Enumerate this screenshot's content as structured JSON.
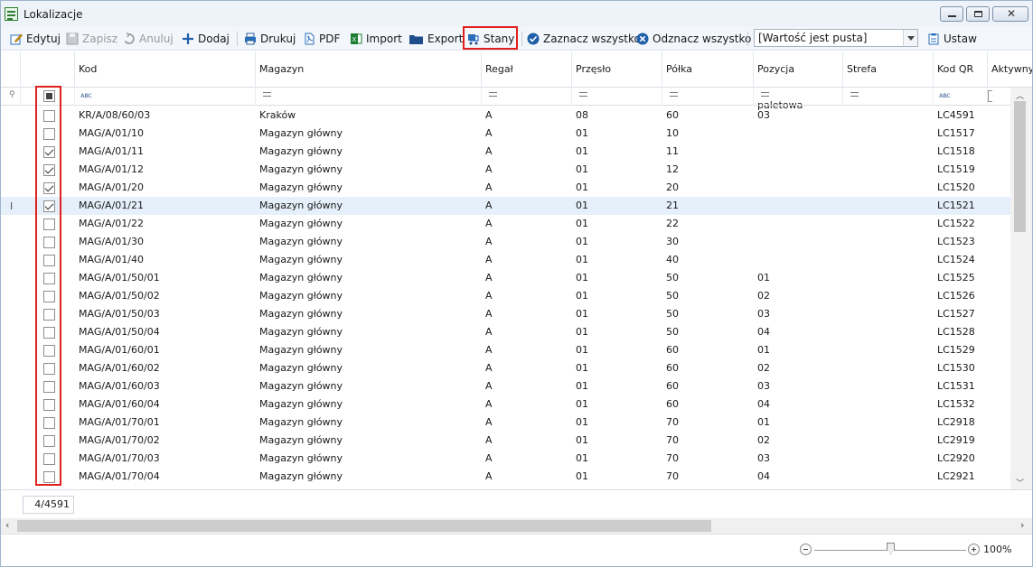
{
  "window": {
    "title": "Lokalizacje"
  },
  "toolbar": {
    "edit": "Edytuj",
    "save": "Zapisz",
    "cancel": "Anuluj",
    "add": "Dodaj",
    "print": "Drukuj",
    "pdf": "PDF",
    "import": "Import",
    "export": "Export",
    "stock": "Stany",
    "select_all": "Zaznacz wszystko",
    "deselect_all": "Odznacz wszystko",
    "filter_value": "[Wartość jest pusta]",
    "set": "Ustaw"
  },
  "columns": [
    "Kod",
    "Magazyn",
    "Regał",
    "Przęsło",
    "Półka",
    "Pozycja paletowa",
    "Strefa",
    "Kod QR",
    "Aktywny"
  ],
  "rows": [
    {
      "checked": false,
      "kod": "KR/A/08/60/03",
      "magazyn": "Kraków",
      "regal": "A",
      "przeslo": "08",
      "polka": "60",
      "pozycja": "03",
      "strefa": "",
      "qr": "LC4591"
    },
    {
      "checked": false,
      "kod": "MAG/A/01/10",
      "magazyn": "Magazyn główny",
      "regal": "A",
      "przeslo": "01",
      "polka": "10",
      "pozycja": "",
      "strefa": "",
      "qr": "LC1517"
    },
    {
      "checked": true,
      "kod": "MAG/A/01/11",
      "magazyn": "Magazyn główny",
      "regal": "A",
      "przeslo": "01",
      "polka": "11",
      "pozycja": "",
      "strefa": "",
      "qr": "LC1518"
    },
    {
      "checked": true,
      "kod": "MAG/A/01/12",
      "magazyn": "Magazyn główny",
      "regal": "A",
      "przeslo": "01",
      "polka": "12",
      "pozycja": "",
      "strefa": "",
      "qr": "LC1519"
    },
    {
      "checked": true,
      "kod": "MAG/A/01/20",
      "magazyn": "Magazyn główny",
      "regal": "A",
      "przeslo": "01",
      "polka": "20",
      "pozycja": "",
      "strefa": "",
      "qr": "LC1520"
    },
    {
      "checked": true,
      "current": true,
      "kod": "MAG/A/01/21",
      "magazyn": "Magazyn główny",
      "regal": "A",
      "przeslo": "01",
      "polka": "21",
      "pozycja": "",
      "strefa": "",
      "qr": "LC1521"
    },
    {
      "checked": false,
      "kod": "MAG/A/01/22",
      "magazyn": "Magazyn główny",
      "regal": "A",
      "przeslo": "01",
      "polka": "22",
      "pozycja": "",
      "strefa": "",
      "qr": "LC1522"
    },
    {
      "checked": false,
      "kod": "MAG/A/01/30",
      "magazyn": "Magazyn główny",
      "regal": "A",
      "przeslo": "01",
      "polka": "30",
      "pozycja": "",
      "strefa": "",
      "qr": "LC1523"
    },
    {
      "checked": false,
      "kod": "MAG/A/01/40",
      "magazyn": "Magazyn główny",
      "regal": "A",
      "przeslo": "01",
      "polka": "40",
      "pozycja": "",
      "strefa": "",
      "qr": "LC1524"
    },
    {
      "checked": false,
      "kod": "MAG/A/01/50/01",
      "magazyn": "Magazyn główny",
      "regal": "A",
      "przeslo": "01",
      "polka": "50",
      "pozycja": "01",
      "strefa": "",
      "qr": "LC1525"
    },
    {
      "checked": false,
      "kod": "MAG/A/01/50/02",
      "magazyn": "Magazyn główny",
      "regal": "A",
      "przeslo": "01",
      "polka": "50",
      "pozycja": "02",
      "strefa": "",
      "qr": "LC1526"
    },
    {
      "checked": false,
      "kod": "MAG/A/01/50/03",
      "magazyn": "Magazyn główny",
      "regal": "A",
      "przeslo": "01",
      "polka": "50",
      "pozycja": "03",
      "strefa": "",
      "qr": "LC1527"
    },
    {
      "checked": false,
      "kod": "MAG/A/01/50/04",
      "magazyn": "Magazyn główny",
      "regal": "A",
      "przeslo": "01",
      "polka": "50",
      "pozycja": "04",
      "strefa": "",
      "qr": "LC1528"
    },
    {
      "checked": false,
      "kod": "MAG/A/01/60/01",
      "magazyn": "Magazyn główny",
      "regal": "A",
      "przeslo": "01",
      "polka": "60",
      "pozycja": "01",
      "strefa": "",
      "qr": "LC1529"
    },
    {
      "checked": false,
      "kod": "MAG/A/01/60/02",
      "magazyn": "Magazyn główny",
      "regal": "A",
      "przeslo": "01",
      "polka": "60",
      "pozycja": "02",
      "strefa": "",
      "qr": "LC1530"
    },
    {
      "checked": false,
      "kod": "MAG/A/01/60/03",
      "magazyn": "Magazyn główny",
      "regal": "A",
      "przeslo": "01",
      "polka": "60",
      "pozycja": "03",
      "strefa": "",
      "qr": "LC1531"
    },
    {
      "checked": false,
      "kod": "MAG/A/01/60/04",
      "magazyn": "Magazyn główny",
      "regal": "A",
      "przeslo": "01",
      "polka": "60",
      "pozycja": "04",
      "strefa": "",
      "qr": "LC1532"
    },
    {
      "checked": false,
      "kod": "MAG/A/01/70/01",
      "magazyn": "Magazyn główny",
      "regal": "A",
      "przeslo": "01",
      "polka": "70",
      "pozycja": "01",
      "strefa": "",
      "qr": "LC2918"
    },
    {
      "checked": false,
      "kod": "MAG/A/01/70/02",
      "magazyn": "Magazyn główny",
      "regal": "A",
      "przeslo": "01",
      "polka": "70",
      "pozycja": "02",
      "strefa": "",
      "qr": "LC2919"
    },
    {
      "checked": false,
      "kod": "MAG/A/01/70/03",
      "magazyn": "Magazyn główny",
      "regal": "A",
      "przeslo": "01",
      "polka": "70",
      "pozycja": "03",
      "strefa": "",
      "qr": "LC2920"
    },
    {
      "checked": false,
      "kod": "MAG/A/01/70/04",
      "magazyn": "Magazyn główny",
      "regal": "A",
      "przeslo": "01",
      "polka": "70",
      "pozycja": "04",
      "strefa": "",
      "qr": "LC2921"
    }
  ],
  "footer": {
    "count": "4/4591"
  },
  "zoom": {
    "label": "100%"
  },
  "colors": {
    "highlight": "#e0201e",
    "current_row": "#e5f0fa"
  },
  "icons": {
    "edit": "pencil-icon",
    "save": "floppy-icon",
    "cancel": "undo-icon",
    "add": "plus-icon",
    "print": "printer-icon",
    "pdf": "pdf-icon",
    "import": "excel-icon",
    "export": "folder-icon",
    "stock": "cart-icon",
    "select_all": "check-circle-icon",
    "deselect_all": "x-circle-icon",
    "set": "clipboard-icon"
  }
}
